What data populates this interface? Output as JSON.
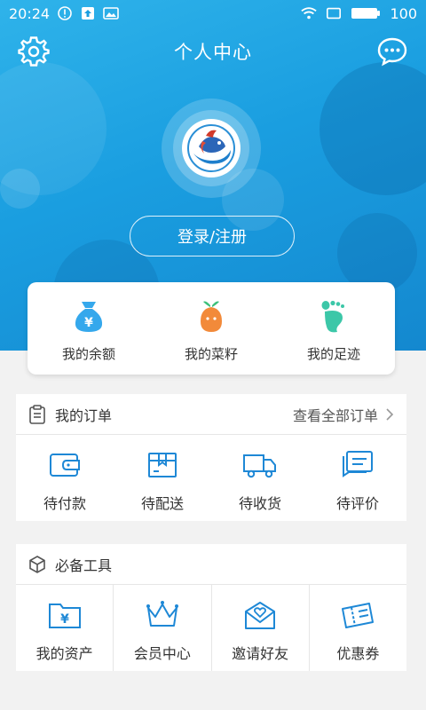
{
  "status_bar": {
    "time": "20:24",
    "battery": "100",
    "icons": [
      "alert-icon",
      "upload-icon",
      "image-icon",
      "wifi-icon",
      "screen-icon",
      "battery-icon"
    ]
  },
  "header": {
    "title": "个人中心",
    "settings_icon": "gear-icon",
    "message_icon": "chat-bubble-icon"
  },
  "profile": {
    "login_label": "登录/注册"
  },
  "wallet": {
    "items": [
      {
        "label": "我的余额",
        "icon": "money-bag-icon",
        "color": "#35a8ec"
      },
      {
        "label": "我的菜籽",
        "icon": "seed-icon",
        "color": "#f28a3a"
      },
      {
        "label": "我的足迹",
        "icon": "footprint-icon",
        "color": "#3cc7a8"
      }
    ]
  },
  "orders": {
    "title": "我的订单",
    "more_label": "查看全部订单",
    "items": [
      {
        "label": "待付款",
        "icon": "wallet-icon"
      },
      {
        "label": "待配送",
        "icon": "package-icon"
      },
      {
        "label": "待收货",
        "icon": "truck-icon"
      },
      {
        "label": "待评价",
        "icon": "comment-icon"
      }
    ]
  },
  "tools": {
    "title": "必备工具",
    "items": [
      {
        "label": "我的资产",
        "icon": "asset-folder-icon"
      },
      {
        "label": "会员中心",
        "icon": "crown-icon"
      },
      {
        "label": "邀请好友",
        "icon": "invite-envelope-icon"
      },
      {
        "label": "优惠券",
        "icon": "coupon-icon"
      }
    ]
  },
  "colors": {
    "accent": "#1a9ee0",
    "icon_blue": "#1e88d6"
  }
}
